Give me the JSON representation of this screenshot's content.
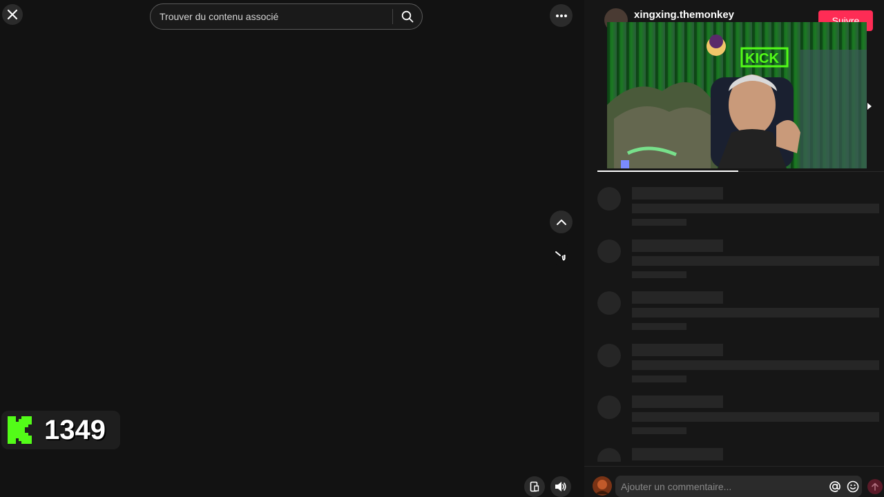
{
  "search": {
    "placeholder": "Trouver du contenu associé"
  },
  "overlay": {
    "count": "1349",
    "brand_color": "#53fc18"
  },
  "creator": {
    "username": "xingxing.themonkey",
    "follow_label": "Suivre"
  },
  "comments": {
    "placeholder": "Ajouter un commentaire...",
    "skeleton_rows": 6
  },
  "colors": {
    "accent": "#fe2c55",
    "background": "#121212"
  },
  "icons": [
    "close-icon",
    "search-icon",
    "more-icon",
    "chevron-up-icon",
    "chevron-down-icon",
    "mobile-icon",
    "volume-icon",
    "mention-icon",
    "emoji-icon",
    "send-icon"
  ]
}
